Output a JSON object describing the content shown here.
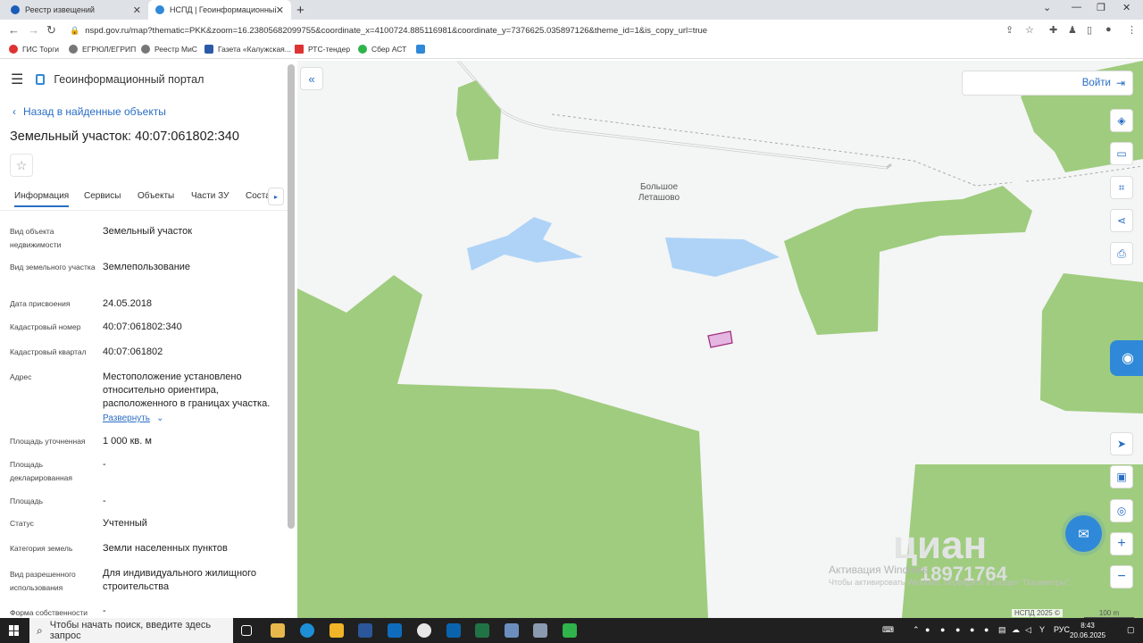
{
  "browser": {
    "tabs": [
      {
        "title": "Реестр извещений",
        "active": false
      },
      {
        "title": "НСПД | Геоинформационный п",
        "active": true
      }
    ],
    "url": "nspd.gov.ru/map?thematic=PKK&zoom=16.23805682099755&coordinate_x=4100724.885116981&coordinate_y=7376625.035897126&theme_id=1&is_copy_url=true",
    "bookmarks": [
      "ГИС Торги",
      "ЕГРЮЛ/ЕГРИП",
      "Реестр МиС",
      "Газета «Калужская...",
      "РТС-тендер",
      "Сбер АСТ"
    ]
  },
  "panel": {
    "portal_name": "Геоинформационный портал",
    "back_link": "Назад в найденные объекты",
    "title": "Земельный участок: 40:07:061802:340",
    "tabs": [
      "Информация",
      "Сервисы",
      "Объекты",
      "Части ЗУ",
      "Соста"
    ],
    "properties": [
      {
        "label": "Вид объекта недвижимости",
        "value": "Земельный участок"
      },
      {
        "label": "Вид земельного участка",
        "value": "Землепользование"
      },
      {
        "label": "Дата присвоения",
        "value": "24.05.2018"
      },
      {
        "label": "Кадастровый номер",
        "value": "40:07:061802:340"
      },
      {
        "label": "Кадастровый квартал",
        "value": "40:07:061802"
      },
      {
        "label": "Адрес",
        "value": "Местоположение установлено относительно ориентира, расположенного в границах участка."
      },
      {
        "label": "Площадь уточненная",
        "value": "1 000 кв. м"
      },
      {
        "label": "Площадь декларированная",
        "value": "-"
      },
      {
        "label": "Площадь",
        "value": "-"
      },
      {
        "label": "Статус",
        "value": "Учтенный"
      },
      {
        "label": "Категория земель",
        "value": "Земли населенных пунктов"
      },
      {
        "label": "Вид разрешенного использования",
        "value": "Для индивидуального жилищного строительства"
      },
      {
        "label": "Форма собственности",
        "value": "-"
      }
    ],
    "expand_link": "Развернуть"
  },
  "map": {
    "login_label": "Войти",
    "place_name_line1": "Большое",
    "place_name_line2": "Леташово",
    "footer": "НСПД 2025 ©",
    "scale": "100 m",
    "watermark_line1": "Активация Windows",
    "watermark_line2": "Чтобы активировать Windows, перейдите в раздел \"Параметры\".",
    "bg_watermark": "циан",
    "bg_phone": "18971764",
    "colors": {
      "forest": "#9fcc7e",
      "water": "#aed3f7",
      "parcel": "#e5b6e2",
      "parcel_border": "#a0307e",
      "accent": "#2f89d8"
    }
  },
  "taskbar": {
    "search_placeholder": "Чтобы начать поиск, введите здесь запрос",
    "lang": "РУС",
    "time": "8:43",
    "date": "20.06.2025"
  }
}
